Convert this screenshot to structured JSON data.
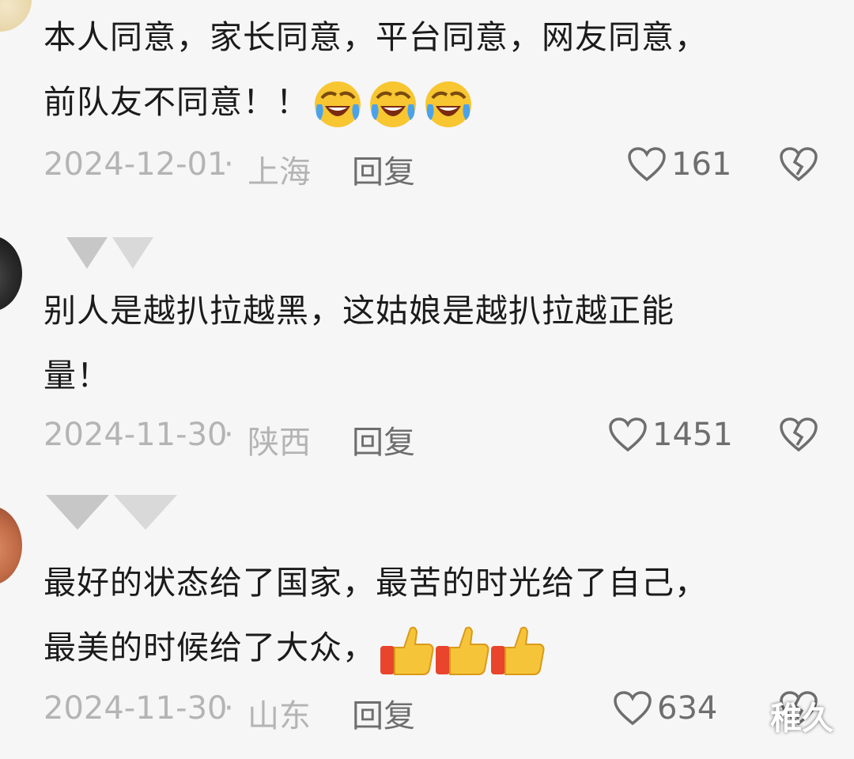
{
  "comments": [
    {
      "text_lines": [
        "本人同意，家长同意，平台同意，网友同意，",
        "前队友不同意！！"
      ],
      "emoji_name": "laugh-cry-emoji",
      "emoji_count": 3,
      "date": "2024-12-01",
      "separator": "·",
      "location": "上海",
      "reply": "回复",
      "likes": "161"
    },
    {
      "text_lines": [
        "别人是越扒拉越黑，这姑娘是越扒拉越正能",
        "量！"
      ],
      "date": "2024-11-30",
      "separator": "·",
      "location": "陕西",
      "reply": "回复",
      "likes": "1451"
    },
    {
      "text_lines": [
        "最好的状态给了国家，最苦的时光给了自己，",
        "最美的时候给了大众，"
      ],
      "emoji_name": "thumbs-up-emoji",
      "emoji_count": 3,
      "date": "2024-11-30",
      "separator": "·",
      "location": "山东",
      "reply": "回复",
      "likes": "634"
    }
  ],
  "watermark": "稚久",
  "colors": {
    "background": "#f6f6f6",
    "text": "#1b1b1b",
    "meta": "#b4b4b4",
    "action": "#6e6e6e"
  }
}
